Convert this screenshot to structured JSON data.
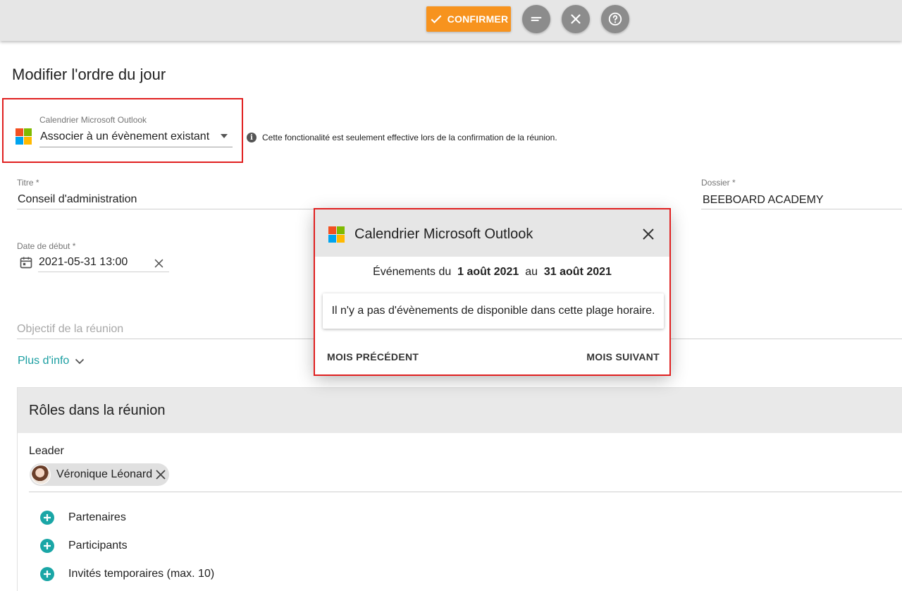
{
  "toolbar": {
    "confirm_label": "CONFIRMER",
    "buttons": [
      {
        "icon": "minimize-icon"
      },
      {
        "icon": "close-icon"
      },
      {
        "icon": "help-icon"
      }
    ],
    "accent_color": "#f7931e"
  },
  "page_title": "Modifier l'ordre du jour",
  "outlook_selector": {
    "label": "Calendrier Microsoft Outlook",
    "value": "Associer à un évènement existant",
    "info_note": "Cette fonctionalité est seulement effective lors de la confirmation de la réunion."
  },
  "fields": {
    "title_label": "Titre *",
    "title_value": "Conseil d'administration",
    "folder_label": "Dossier *",
    "folder_value": "BEEBOARD ACADEMY",
    "start_label": "Date de début *",
    "start_value": "2021-05-31 13:00",
    "objective_placeholder": "Objectif de la réunion",
    "more_info": "Plus d'info"
  },
  "roles": {
    "header": "Rôles dans la réunion",
    "leader_label": "Leader",
    "leader_name": "Véronique Léonard",
    "items": [
      {
        "label": "Partenaires"
      },
      {
        "label": "Participants"
      },
      {
        "label": "Invités temporaires (max. 10)"
      }
    ],
    "accent_color": "#1aa6a6"
  },
  "dialog": {
    "title": "Calendrier Microsoft Outlook",
    "range_prefix": "Événements du",
    "range_start": "1 août 2021",
    "range_mid": "au",
    "range_end": "31 août 2021",
    "empty_message": "Il n'y a pas d'évènements de disponible dans cette plage horaire.",
    "prev_label": "MOIS PRÉCÉDENT",
    "next_label": "MOIS SUIVANT"
  }
}
